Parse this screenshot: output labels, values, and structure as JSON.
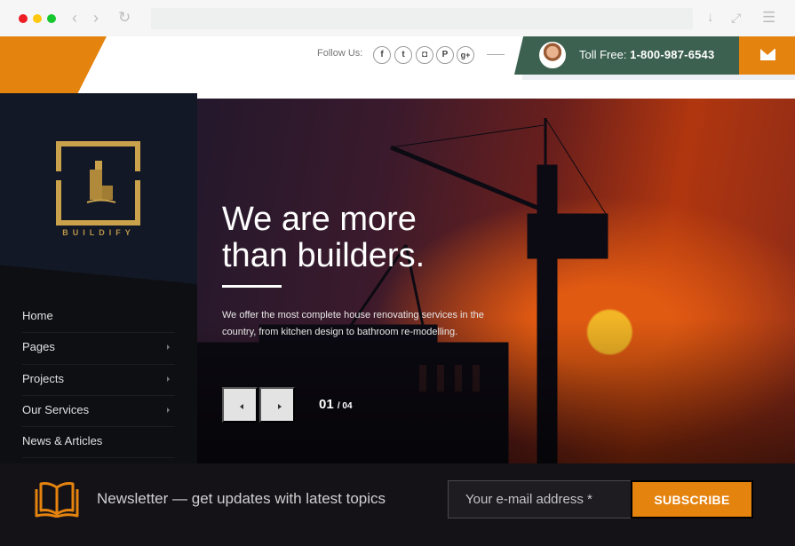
{
  "browser": {
    "icons": [
      "back-icon",
      "forward-icon",
      "reload-icon",
      "download-icon",
      "fullscreen-icon",
      "menu-icon"
    ],
    "address_value": ""
  },
  "header": {
    "follow_label": "Follow Us:",
    "social": [
      {
        "name": "facebook",
        "glyph": "f"
      },
      {
        "name": "twitter",
        "glyph": "t"
      },
      {
        "name": "instagram",
        "glyph": "◘"
      },
      {
        "name": "pinterest",
        "glyph": "P"
      },
      {
        "name": "google-plus",
        "glyph": "g+"
      }
    ],
    "toll_label": "Toll Free:",
    "toll_number": "1-800-987-6543",
    "colors": {
      "accent": "#e5830f",
      "green": "#3c6150"
    }
  },
  "sidebar": {
    "logo_text": "BUILDIFY",
    "nav": [
      {
        "label": "Home",
        "has_submenu": false
      },
      {
        "label": "Pages",
        "has_submenu": true
      },
      {
        "label": "Projects",
        "has_submenu": true
      },
      {
        "label": "Our Services",
        "has_submenu": true
      },
      {
        "label": "News & Articles",
        "has_submenu": false
      }
    ]
  },
  "hero": {
    "title_line1": "We are more",
    "title_line2": "than builders.",
    "description": "We offer the most complete house renovating services in the country, from kitchen design to bathroom re-modelling.",
    "slide_current": "01",
    "slide_total": "/ 04"
  },
  "newsletter": {
    "text": "Newsletter — get updates with latest topics",
    "email_placeholder": "Your e-mail address *",
    "subscribe_label": "SUBSCRIBE"
  }
}
